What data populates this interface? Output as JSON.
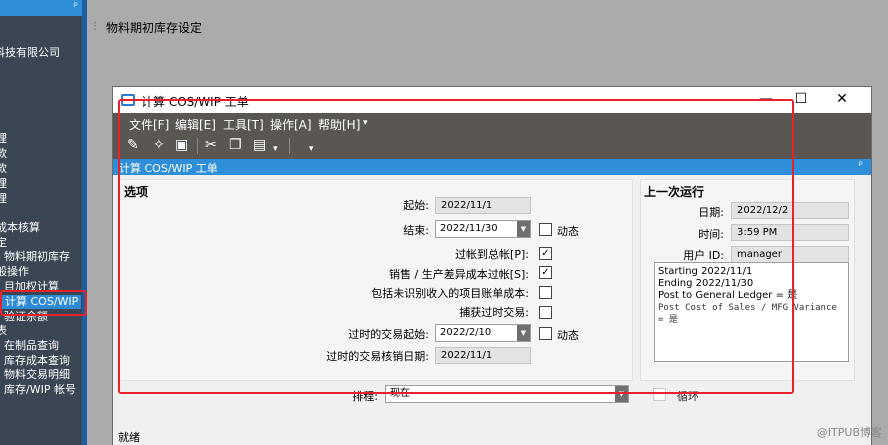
{
  "leftnav": {
    "company": "科技有限公司",
    "items": [
      {
        "label": "理"
      },
      {
        "label": "款"
      },
      {
        "label": "款"
      },
      {
        "label": "理"
      },
      {
        "label": "理"
      },
      {
        "label": "成本核算"
      },
      {
        "label": "定"
      },
      {
        "label": "物料期初库存"
      },
      {
        "label": "般操作"
      },
      {
        "label": "目加权计算"
      },
      {
        "label": "计算 COS/WIP"
      },
      {
        "label": "验证余额"
      },
      {
        "label": "表"
      },
      {
        "label": "在制品查询"
      },
      {
        "label": "库存成本查询"
      },
      {
        "label": "物料交易明细"
      },
      {
        "label": "库存/WIP 帐号"
      }
    ]
  },
  "bg_tab": {
    "title": "物料期初库存设定"
  },
  "dialog": {
    "title": "计算 COS/WIP 工单",
    "min": "—",
    "max": "☐",
    "close": "✕"
  },
  "menu": {
    "file": "文件[F]",
    "edit": "编辑[E]",
    "tools": "工具[T]",
    "action": "操作[A]",
    "help": "帮助[H]",
    "more": "▾"
  },
  "toolbar": {
    "more": "▾"
  },
  "panel": {
    "title": "计算 COS/WIP 工单",
    "pin": "ᵖ"
  },
  "options": {
    "title": "选项",
    "start_label": "起始:",
    "start_value": "2022/11/1",
    "end_label": "结束:",
    "end_value": "2022/11/30",
    "dynamic1": "动态",
    "post_gl": "过帐到总帐[P]:",
    "post_cos": "销售 / 生产差异成本过帐[S]:",
    "include_unrec": "包括未识别收入的项目账单成本:",
    "capture": "捕获过时交易:",
    "old_start_label": "过时的交易起始:",
    "old_start_value": "2022/2/10",
    "dynamic2": "动态",
    "old_end_label": "过时的交易核销日期:",
    "old_end_value": "2022/11/1"
  },
  "checkboxes": {
    "dynamic1": false,
    "post_gl": true,
    "post_cos": true,
    "include_unrec": false,
    "capture": false,
    "dynamic2": false,
    "loop": false
  },
  "last_run": {
    "title": "上一次运行",
    "date_label": "日期:",
    "date_value": "2022/12/2",
    "time_label": "时间:",
    "time_value": "3:59 PM",
    "user_label": "用户 ID:",
    "user_value": "manager",
    "log": [
      "Starting 2022/11/1",
      "Ending 2022/11/30",
      "Post to General Ledger = 是",
      "Post Cost of Sales / MFG Variance",
      "= 是"
    ]
  },
  "schedule": {
    "label": "排程:",
    "value": "现在",
    "loop_label": "循环"
  },
  "status": "就绪",
  "watermark": "@ITPUB博客",
  "colors": {
    "accent": "#2e8fd8",
    "highlight": "#e8222a",
    "menubar": "#5a5753",
    "nav": "#3a4654"
  }
}
